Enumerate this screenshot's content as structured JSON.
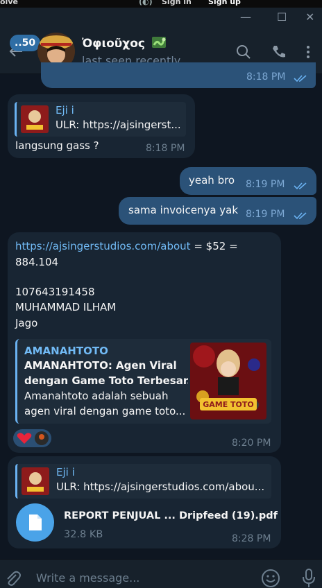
{
  "topbar": {
    "left_text": "olve",
    "signin_label": "Sign in",
    "signup_label": "Sign up"
  },
  "header": {
    "unread_count": "..50",
    "chat_title": "Ὀφιοῦχος",
    "chat_status": "last seen recently"
  },
  "messages": {
    "m0": {
      "time": "8:18 PM"
    },
    "m1": {
      "reply_name": "Eji i",
      "reply_text": "ULR: https://ajsingerst...",
      "text": "langsung gass ?",
      "time": "8:18 PM"
    },
    "m2": {
      "text": "yeah bro",
      "time": "8:19 PM"
    },
    "m3": {
      "text": "sama invoicenya yak",
      "time": "8:19 PM"
    },
    "m4": {
      "link": "https://ajsingerstudios.com/about",
      "text_suffix": " = $52 =",
      "line2": "884.104",
      "line3": "107643191458",
      "line4": "MUHAMMAD ILHAM",
      "line5": "Jago",
      "preview_site": "AMANAHTOTO",
      "preview_title_1": "AMANAHTOTO: Agen Viral",
      "preview_title_2": "dengan Game Toto Terbesar...",
      "preview_desc_1": "Amanahtoto adalah sebuah",
      "preview_desc_2": "agen viral dengan game toto...",
      "preview_image_caption": "GAME TOTO",
      "time": "8:20 PM"
    },
    "m5": {
      "reply_name": "Eji i",
      "reply_text": "ULR: https://ajsingerstudios.com/abou...",
      "file_name": "REPORT PENJUAL ...  Dripfeed (19).pdf",
      "file_size": "32.8 KB",
      "time": "8:28 PM"
    }
  },
  "composer": {
    "placeholder": "Write a message..."
  },
  "colors": {
    "background": "#0e1621",
    "incoming": "#182533",
    "outgoing": "#2b5278",
    "accent": "#6ab2f2"
  }
}
